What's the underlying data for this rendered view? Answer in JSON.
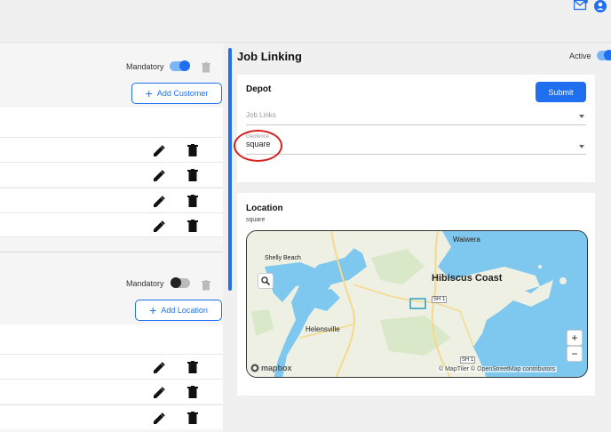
{
  "header": {
    "mail_icon": "mail-icon",
    "user_icon": "user-account-icon"
  },
  "customers": {
    "mandatory_label": "Mandatory",
    "mandatory_on": true,
    "add_button": "Add Customer",
    "row_count": 4
  },
  "locations": {
    "mandatory_label": "Mandatory",
    "mandatory_on": false,
    "add_button": "Add Location",
    "row_count": 3
  },
  "job_linking": {
    "title": "Job Linking",
    "active_label": "Active",
    "active_on": true
  },
  "depot": {
    "title": "Depot",
    "submit_label": "Submit",
    "job_links_placeholder": "Job Links",
    "geofence_label": "Geofence",
    "geofence_value": "square"
  },
  "location": {
    "title": "Location",
    "subtitle": "square",
    "map": {
      "labels": {
        "waiwera": "Waiwera",
        "shelly_beach": "Shelly Beach",
        "hibiscus_coast": "Hibiscus Coast",
        "helensville": "Helensville",
        "sh1_a": "SH 1",
        "sh1_b": "SH 1"
      },
      "attribution": "© MapTiler © OpenStreetMap contributors",
      "logo": "mapbox",
      "zoom_in": "+",
      "zoom_out": "−"
    }
  },
  "colors": {
    "accent": "#1f6ff0",
    "highlight_ring": "#d9201c",
    "water": "#7ec8f0",
    "land": "#eef0e4"
  }
}
